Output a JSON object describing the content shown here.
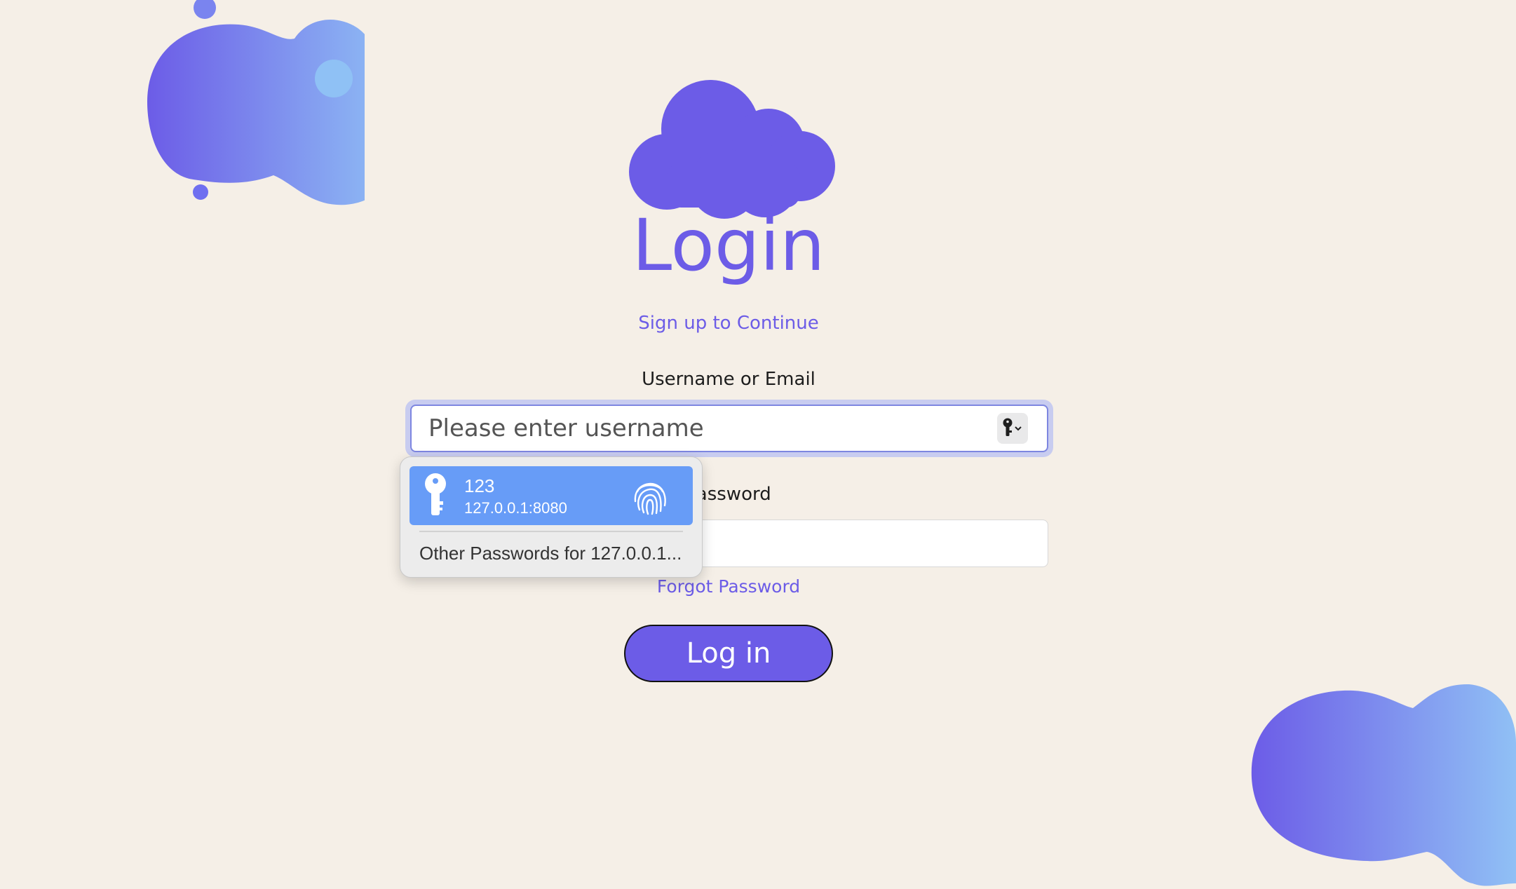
{
  "header": {
    "title": "Login",
    "subtitle": "Sign up to Continue"
  },
  "form": {
    "username_label": "Username or Email",
    "username_placeholder": "Please enter username",
    "username_value": "",
    "password_label": "Password",
    "password_value": "",
    "forgot_link": "Forgot Password",
    "submit_label": "Log in"
  },
  "password_autofill": {
    "suggestion": {
      "username": "123",
      "host": "127.0.0.1:8080",
      "icon": "key-icon",
      "auth_icon": "fingerprint-icon"
    },
    "other_passwords": "Other Passwords for 127.0.0.1..."
  },
  "icons": {
    "logo": "cloud-icon",
    "field_autofill": "key-icon"
  },
  "colors": {
    "background": "#f5efe7",
    "accent": "#6c5ce7",
    "blob_start": "#6c5ce7",
    "blob_end": "#8fc1f5",
    "autofill_highlight": "#679cf7"
  }
}
